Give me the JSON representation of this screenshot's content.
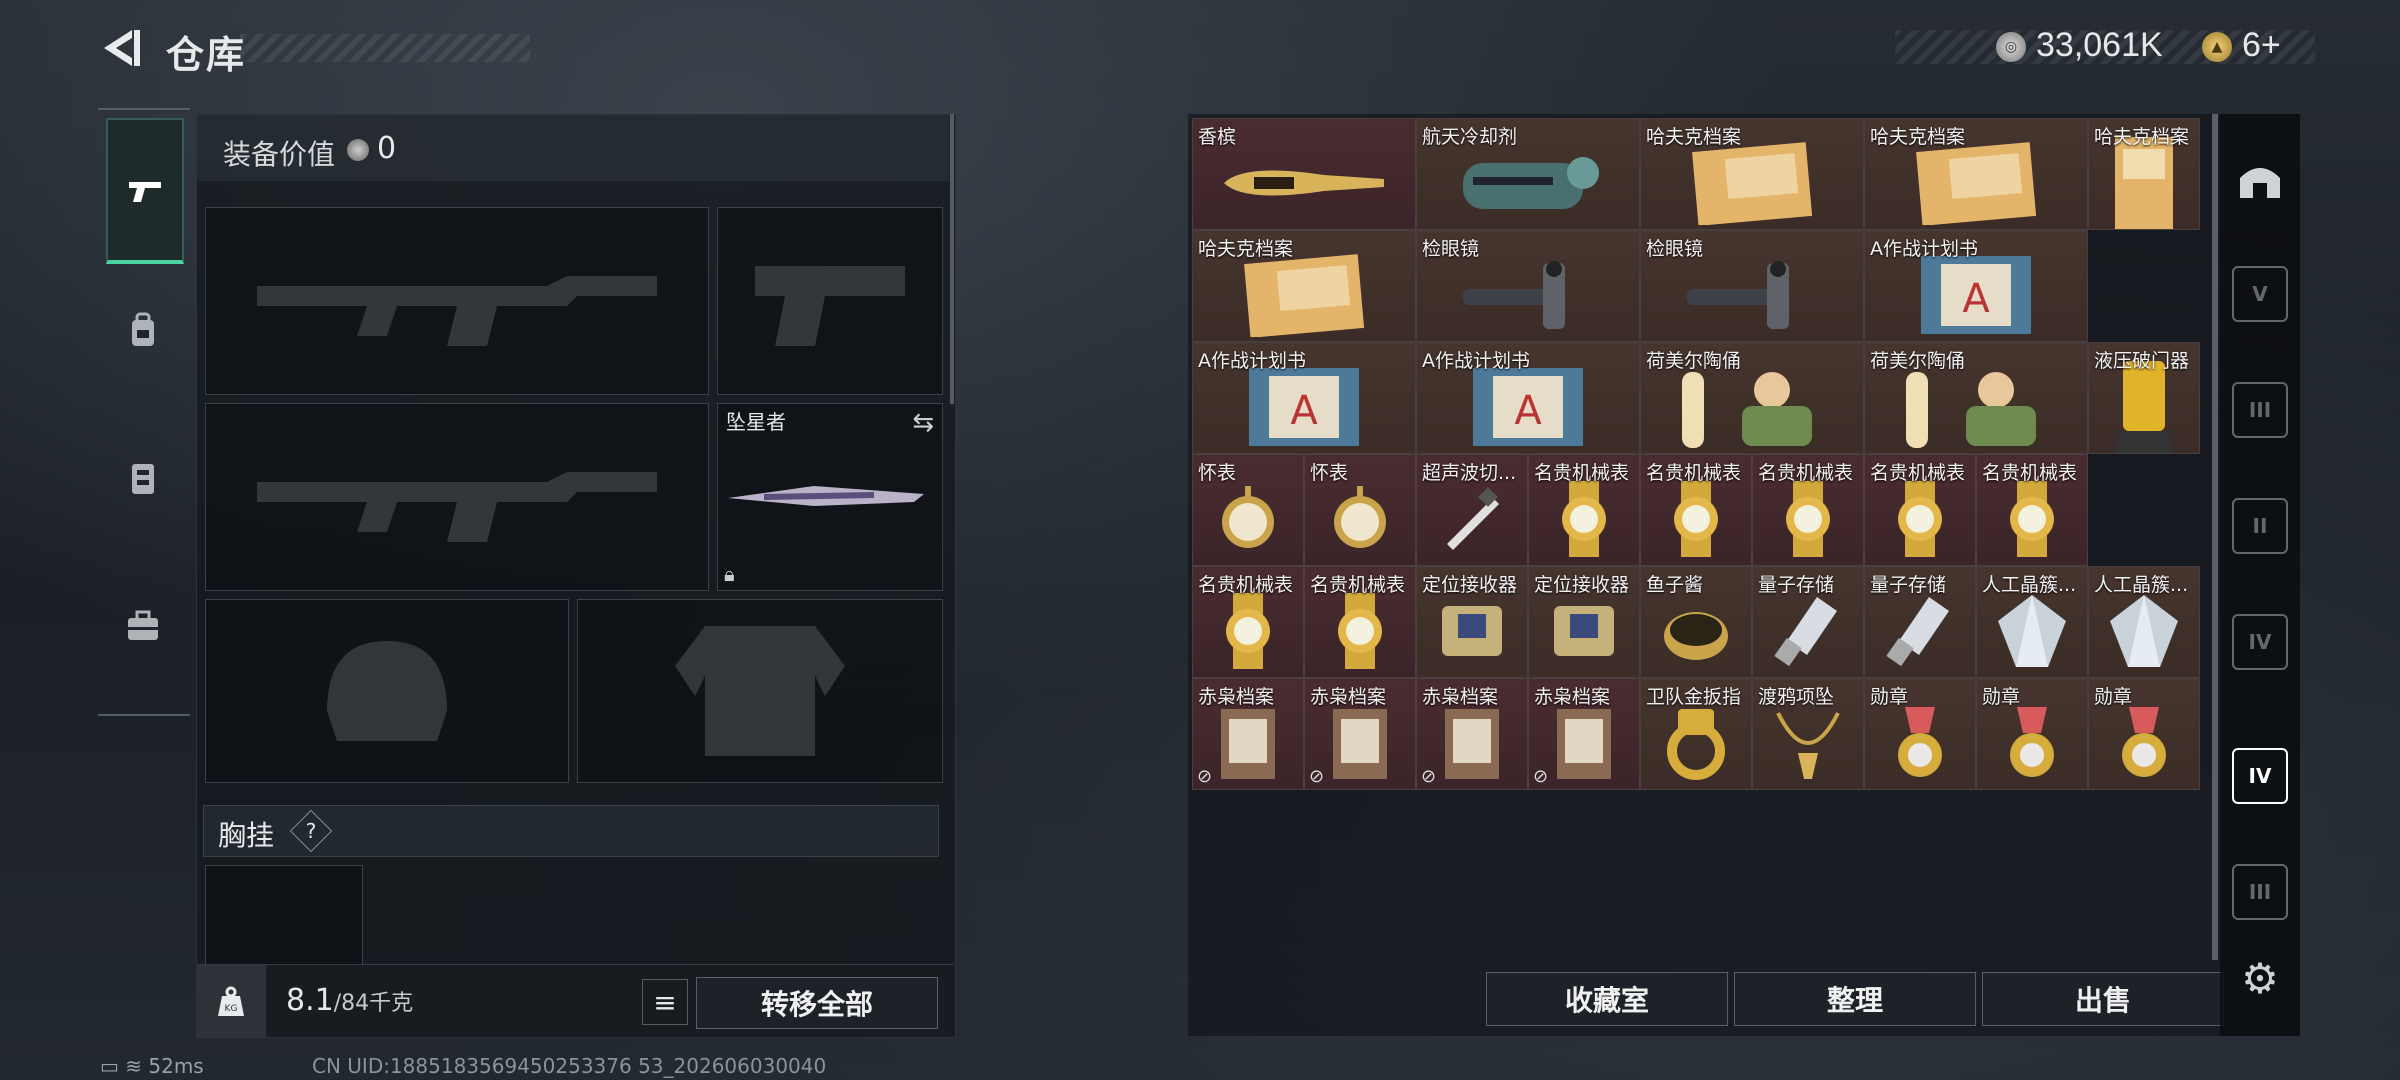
{
  "header": {
    "title": "仓库",
    "currency": "33,061K",
    "tickets": "6+"
  },
  "equipment": {
    "value_label": "装备价值",
    "value": "0",
    "melee_name": "坠星者",
    "chest_label": "胸挂",
    "chest_help": "?"
  },
  "weight": {
    "current": "8.1",
    "max": "/84千克",
    "kg_icon": "KG"
  },
  "buttons": {
    "transfer_all": "转移全部",
    "collection": "收藏室",
    "sort": "整理",
    "sell": "出售"
  },
  "status": {
    "ping": "52ms",
    "uid": "CN UID:1885183569450253376 53_202606030040"
  },
  "storage_rows": [
    [
      "香槟",
      "航天冷却剂",
      "哈夫克档案",
      "哈夫克档案",
      "哈夫克档案"
    ],
    [
      "哈夫克档案",
      "检眼镜",
      "检眼镜",
      "A作战计划书"
    ],
    [
      "A作战计划书",
      "A作战计划书",
      "荷美尔陶俑",
      "荷美尔陶俑",
      "液压破门器"
    ],
    [
      "怀表",
      "怀表",
      "超声波切...",
      "名贵机械表",
      "名贵机械表",
      "名贵机械表",
      "名贵机械表",
      "名贵机械表"
    ],
    [
      "名贵机械表",
      "名贵机械表",
      "定位接收器",
      "定位接收器",
      "鱼子酱",
      "量子存储",
      "量子存储",
      "人工晶簇...",
      "人工晶簇..."
    ],
    [
      "赤枭档案",
      "赤枭档案",
      "赤枭档案",
      "赤枭档案",
      "卫队金扳指",
      "渡鸦项坠",
      "勋章",
      "勋章",
      "勋章"
    ]
  ],
  "rail": [
    "V",
    "III",
    "II",
    "IV",
    "IV",
    "III"
  ],
  "colors": {
    "accent": "#4ad6a4",
    "rare_red": "#4a2c30",
    "rare_brown": "#46352e"
  }
}
